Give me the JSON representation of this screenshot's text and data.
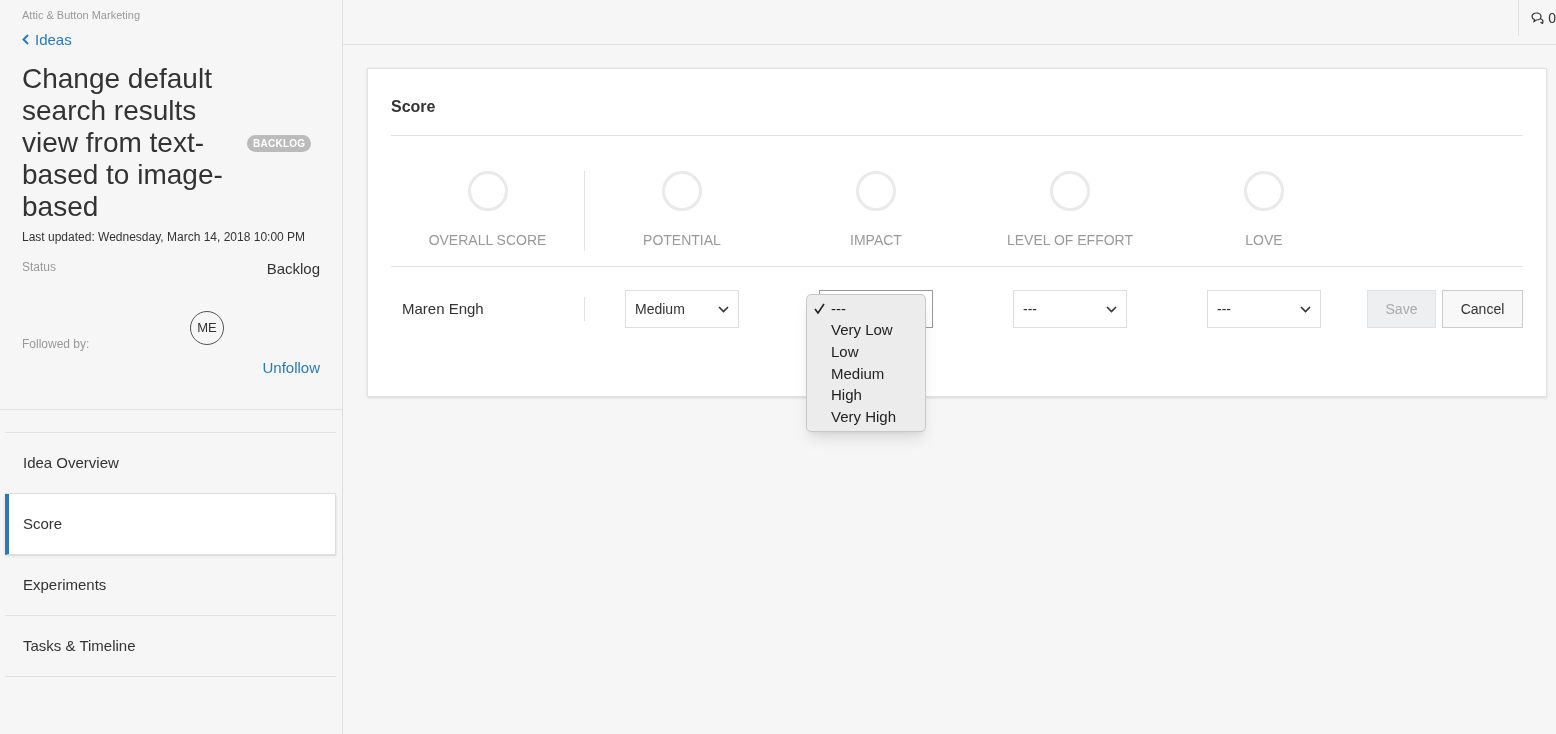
{
  "sidebar": {
    "workspace": "Attic & Button Marketing",
    "back_link": "Ideas",
    "title": "Change default search results view from text-based to image-based",
    "badge": "BACKLOG",
    "last_updated": "Last updated: Wednesday, March 14, 2018 10:00 PM",
    "status_label": "Status",
    "status_value": "Backlog",
    "followed_label": "Followed by:",
    "follower_initials": "ME",
    "unfollow": "Unfollow",
    "nav": [
      {
        "label": "Idea Overview",
        "selected": false
      },
      {
        "label": "Score",
        "selected": true
      },
      {
        "label": "Experiments",
        "selected": false
      },
      {
        "label": "Tasks & Timeline",
        "selected": false
      }
    ]
  },
  "top_bar": {
    "comments_count": "0"
  },
  "score_card": {
    "title": "Score",
    "metrics": [
      {
        "label": "OVERALL SCORE"
      },
      {
        "label": "POTENTIAL"
      },
      {
        "label": "IMPACT"
      },
      {
        "label": "LEVEL OF EFFORT"
      },
      {
        "label": "LOVE"
      }
    ],
    "row": {
      "name": "Maren Engh",
      "selects": [
        {
          "value": "Medium",
          "open": false
        },
        {
          "open": true
        },
        {
          "value": "---",
          "open": false
        },
        {
          "value": "---",
          "open": false
        }
      ],
      "save": {
        "label": "Save",
        "disabled": true
      },
      "cancel": {
        "label": "Cancel"
      }
    },
    "dropdown_options": [
      {
        "label": "---",
        "selected": true
      },
      {
        "label": "Very Low",
        "selected": false
      },
      {
        "label": "Low",
        "selected": false
      },
      {
        "label": "Medium",
        "selected": false
      },
      {
        "label": "High",
        "selected": false
      },
      {
        "label": "Very High",
        "selected": false
      }
    ]
  }
}
